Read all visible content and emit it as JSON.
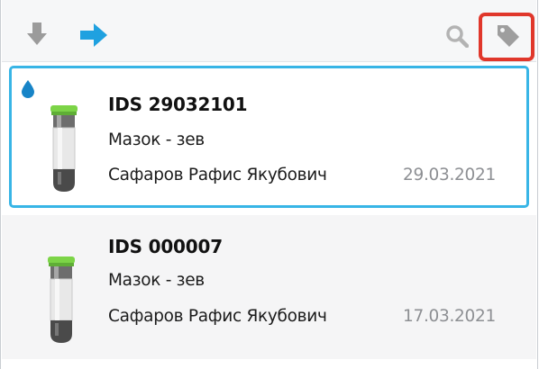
{
  "toolbar": {
    "icons": [
      "down-arrow-icon",
      "right-arrow-icon",
      "search-icon",
      "tag-icon"
    ],
    "colors": {
      "download_gray": "#9b9b9b",
      "arrow_blue": "#1fa1e0",
      "highlight_red": "#e0372b"
    }
  },
  "samples": [
    {
      "id": "IDS 29032101",
      "specimen": "Мазок - зев",
      "patient": "Сафаров Рафис Якубович",
      "date": "29.03.2021",
      "selected": true,
      "has_drop": true
    },
    {
      "id": "IDS 000007",
      "specimen": "Мазок - зев",
      "patient": "Сафаров Рафис Якубович",
      "date": "17.03.2021",
      "selected": false,
      "has_drop": false
    }
  ],
  "colors": {
    "selected_border": "#38b5e6",
    "drop": "#1784c7",
    "tube_cap": "#7cd447"
  }
}
